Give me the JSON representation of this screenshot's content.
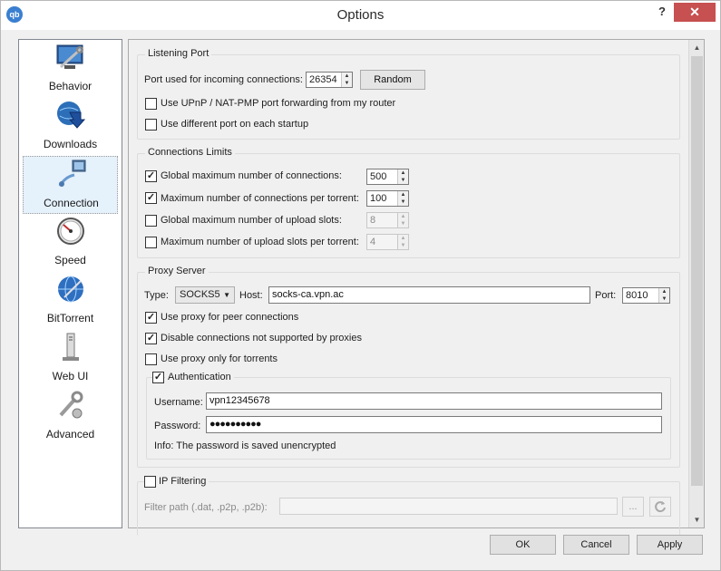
{
  "window": {
    "title": "Options",
    "app_icon": "qb",
    "help": "?",
    "close": "✕"
  },
  "sidebar": {
    "items": [
      {
        "label": "Behavior",
        "icon": "monitor-wrench-icon"
      },
      {
        "label": "Downloads",
        "icon": "globe-download-icon"
      },
      {
        "label": "Connection",
        "icon": "network-plug-icon",
        "selected": true
      },
      {
        "label": "Speed",
        "icon": "speedometer-icon"
      },
      {
        "label": "BitTorrent",
        "icon": "globe-network-icon"
      },
      {
        "label": "Web UI",
        "icon": "server-icon"
      },
      {
        "label": "Advanced",
        "icon": "gears-icon"
      }
    ]
  },
  "listening_port": {
    "title": "Listening Port",
    "port_label": "Port used for incoming connections:",
    "port_value": "26354",
    "random_button": "Random",
    "upnp_label": "Use UPnP / NAT-PMP port forwarding from my router",
    "upnp_checked": false,
    "diff_port_label": "Use different port on each startup",
    "diff_port_checked": false
  },
  "connection_limits": {
    "title": "Connections Limits",
    "rows": [
      {
        "label": "Global maximum number of connections:",
        "checked": true,
        "value": "500"
      },
      {
        "label": "Maximum number of connections per torrent:",
        "checked": true,
        "value": "100"
      },
      {
        "label": "Global maximum number of upload slots:",
        "checked": false,
        "value": "8"
      },
      {
        "label": "Maximum number of upload slots per torrent:",
        "checked": false,
        "value": "4"
      }
    ]
  },
  "proxy": {
    "title": "Proxy Server",
    "type_label": "Type:",
    "type_value": "SOCKS5",
    "host_label": "Host:",
    "host_value": "socks-ca.vpn.ac",
    "port_label": "Port:",
    "port_value": "8010",
    "peer_label": "Use proxy for peer connections",
    "peer_checked": true,
    "disable_label": "Disable connections not supported by proxies",
    "disable_checked": true,
    "torrents_only_label": "Use proxy only for torrents",
    "torrents_only_checked": false,
    "auth": {
      "title": "Authentication",
      "checked": true,
      "username_label": "Username:",
      "username_value": "vpn12345678",
      "password_label": "Password:",
      "password_value": "●●●●●●●●●●",
      "info": "Info: The password is saved unencrypted"
    }
  },
  "ip_filtering": {
    "title": "IP Filtering",
    "checked": false,
    "filter_label": "Filter path (.dat, .p2p, .p2b):",
    "filter_value": "",
    "browse_button": "...",
    "reload_icon": "refresh-icon"
  },
  "footer": {
    "ok": "OK",
    "cancel": "Cancel",
    "apply": "Apply"
  },
  "colors": {
    "close_button": "#c75050",
    "selection": "#e5f1fb"
  }
}
